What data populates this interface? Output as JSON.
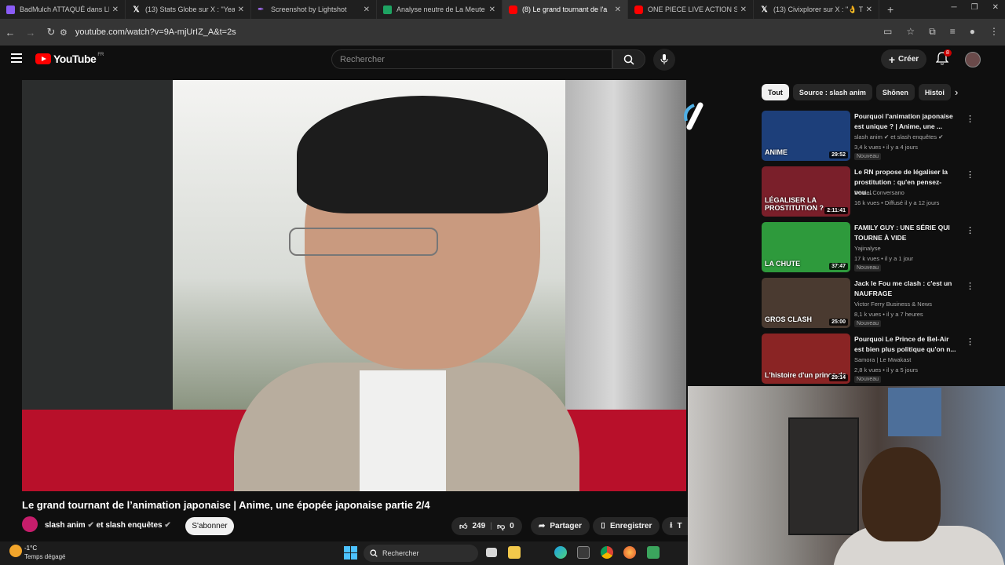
{
  "browser": {
    "tabs": [
      {
        "title": "BadMulch ATTAQUÉ dans LIBÉ",
        "icon": "purple",
        "active": false
      },
      {
        "title": "(13) Stats Globe sur X : \"Year W",
        "icon": "x",
        "active": false
      },
      {
        "title": "Screenshot by Lightshot",
        "icon": "feather",
        "active": false
      },
      {
        "title": "Analyse neutre de La Meute - G",
        "icon": "sheets",
        "active": false
      },
      {
        "title": "(8) Le grand tournant de l'a",
        "icon": "youtube",
        "active": true
      },
      {
        "title": "ONE PIECE LIVE ACTION SAISO",
        "icon": "youtube",
        "active": false
      },
      {
        "title": "(13) Civixplorer sur X : \"👌 The",
        "icon": "x",
        "active": false
      }
    ],
    "new_tab": "+",
    "url": "youtube.com/watch?v=9A-mjUrIZ_A&t=2s"
  },
  "youtube": {
    "logo_text": "YouTube",
    "country": "FR",
    "search_placeholder": "Rechercher",
    "create_label": "Créer",
    "notif_count": "8"
  },
  "video": {
    "title": "Le grand tournant de l’animation japonaise | Anime, une épopée japonaise partie 2/4",
    "channel": "slash anim",
    "channel_extra": "et slash enquêtes",
    "subscribe_label": "S'abonner",
    "likes": "249",
    "dislikes": "0",
    "share_label": "Partager",
    "save_label": "Enregistrer",
    "download_label": "T"
  },
  "sidebar": {
    "chips": [
      "Tout",
      "Source : slash anim",
      "Shōnen",
      "Histoi"
    ],
    "recs": [
      {
        "title": "Pourquoi l'animation japonaise est unique ? | Anime, une ...",
        "channel": "slash anim ✔ et slash enquêtes ✔",
        "meta": "3,4 k vues • il y a 4 jours",
        "badge": "Nouveau",
        "duration": "29:52",
        "thumb_text": "ANIME",
        "thumb_color": "#1d3f7a"
      },
      {
        "title": "Le RN propose de légaliser la prostitution : qu'en pensez-vou...",
        "channel": "Daniel Conversano",
        "meta": "16 k vues • Diffusé il y a 12 jours",
        "badge": "",
        "duration": "2:11:41",
        "thumb_text": "LÉGALISER LA PROSTITUTION ?",
        "thumb_color": "#7a1f2a"
      },
      {
        "title": "FAMILY GUY : UNE SÉRIE QUI TOURNE À VIDE",
        "channel": "Yajinalyse",
        "meta": "17 k vues • il y a 1 jour",
        "badge": "Nouveau",
        "duration": "37:47",
        "thumb_text": "LA CHUTE",
        "thumb_color": "#2e9a3c"
      },
      {
        "title": "Jack le Fou me clash : c'est un NAUFRAGE",
        "channel": "Victor Ferry Business & News",
        "meta": "8,1 k vues • il y a 7 heures",
        "badge": "Nouveau",
        "duration": "25:00",
        "thumb_text": "GROS CLASH",
        "thumb_color": "#4a3a30"
      },
      {
        "title": "Pourquoi Le Prince de Bel-Air est bien plus politique qu'on n...",
        "channel": "Samora | Le Mwakast",
        "meta": "2,8 k vues • il y a 5 jours",
        "badge": "Nouveau",
        "duration": "29:14",
        "thumb_text": "L'histoire d'un prince de",
        "thumb_color": "#8a2424"
      }
    ]
  },
  "taskbar": {
    "temp": "-1°C",
    "weather": "Temps dégagé",
    "search": "Rechercher"
  }
}
